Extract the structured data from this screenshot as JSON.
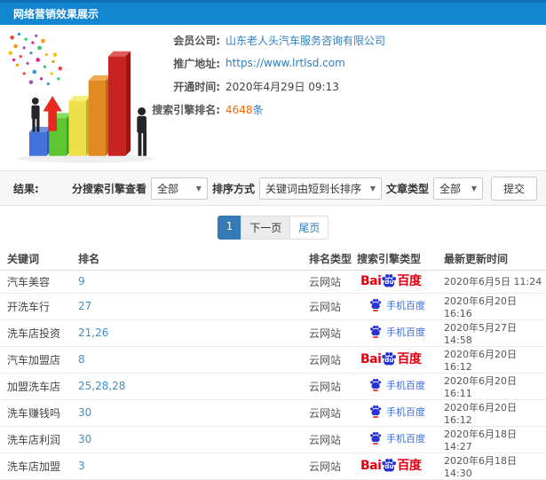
{
  "header": {
    "title": "网络营销效果展示"
  },
  "info": {
    "rows": [
      {
        "label": "会员公司:",
        "value": "山东老人头汽车服务咨询有限公司"
      },
      {
        "label": "推广地址:",
        "value": "https://www.lrtlsd.com"
      },
      {
        "label": "开通时间:",
        "value": "2020年4月29日 09:13"
      },
      {
        "label": "搜索引擎排名:",
        "value": "4648",
        "suffix": "条"
      }
    ]
  },
  "filters": {
    "result_label": "结果:",
    "engine_label": "分搜索引擎查看",
    "engine_value": "全部",
    "sort_label": "排序方式",
    "sort_value": "关键词由短到长排序",
    "article_label": "文章类型",
    "article_value": "全部",
    "submit_label": "提交",
    "caret": "▼"
  },
  "pagination": {
    "items": [
      {
        "label": "1",
        "state": "active"
      },
      {
        "label": "下一页",
        "state": "next"
      },
      {
        "label": "尾页",
        "state": "normal"
      }
    ]
  },
  "table": {
    "columns": [
      "关键词",
      "排名",
      "排名类型",
      "搜索引擎类型",
      "最新更新时间"
    ],
    "rows": [
      {
        "keyword": "汽车美容",
        "rank": "9",
        "rank_type": "云网站",
        "engine": "baidu",
        "updated": "2020年6月5日 11:24"
      },
      {
        "keyword": "开洗车行",
        "rank": "27",
        "rank_type": "云网站",
        "engine": "mobile",
        "updated": "2020年6月20日 16:16"
      },
      {
        "keyword": "洗车店投资",
        "rank": "21,26",
        "rank_type": "云网站",
        "engine": "mobile",
        "updated": "2020年5月27日 14:58"
      },
      {
        "keyword": "汽车加盟店",
        "rank": "8",
        "rank_type": "云网站",
        "engine": "baidu",
        "updated": "2020年6月20日 16:12"
      },
      {
        "keyword": "加盟洗车店",
        "rank": "25,28,28",
        "rank_type": "云网站",
        "engine": "mobile",
        "updated": "2020年6月20日 16:11"
      },
      {
        "keyword": "洗车赚钱吗",
        "rank": "30",
        "rank_type": "云网站",
        "engine": "mobile",
        "updated": "2020年6月20日 16:12"
      },
      {
        "keyword": "洗车店利润",
        "rank": "30",
        "rank_type": "云网站",
        "engine": "mobile",
        "updated": "2020年6月18日 14:27"
      },
      {
        "keyword": "洗车店加盟",
        "rank": "3",
        "rank_type": "云网站",
        "engine": "baidu",
        "updated": "2020年6月18日 14:30"
      }
    ]
  },
  "logos": {
    "baidu": {
      "prefix": "Bai",
      "du": "du",
      "suffix": "百度"
    },
    "mobile": {
      "label": "手机百度"
    }
  },
  "colors": {
    "header_bg": "#1385d1",
    "link_blue": "#2e7fc1",
    "rank_blue": "#3f8ec9",
    "highlight_orange": "#ff6600",
    "baidu_red": "#e10012",
    "baidu_paw_blue": "#2733d3",
    "mobile_text_blue": "#3a6ce0",
    "pager_active": "#337ab7"
  }
}
